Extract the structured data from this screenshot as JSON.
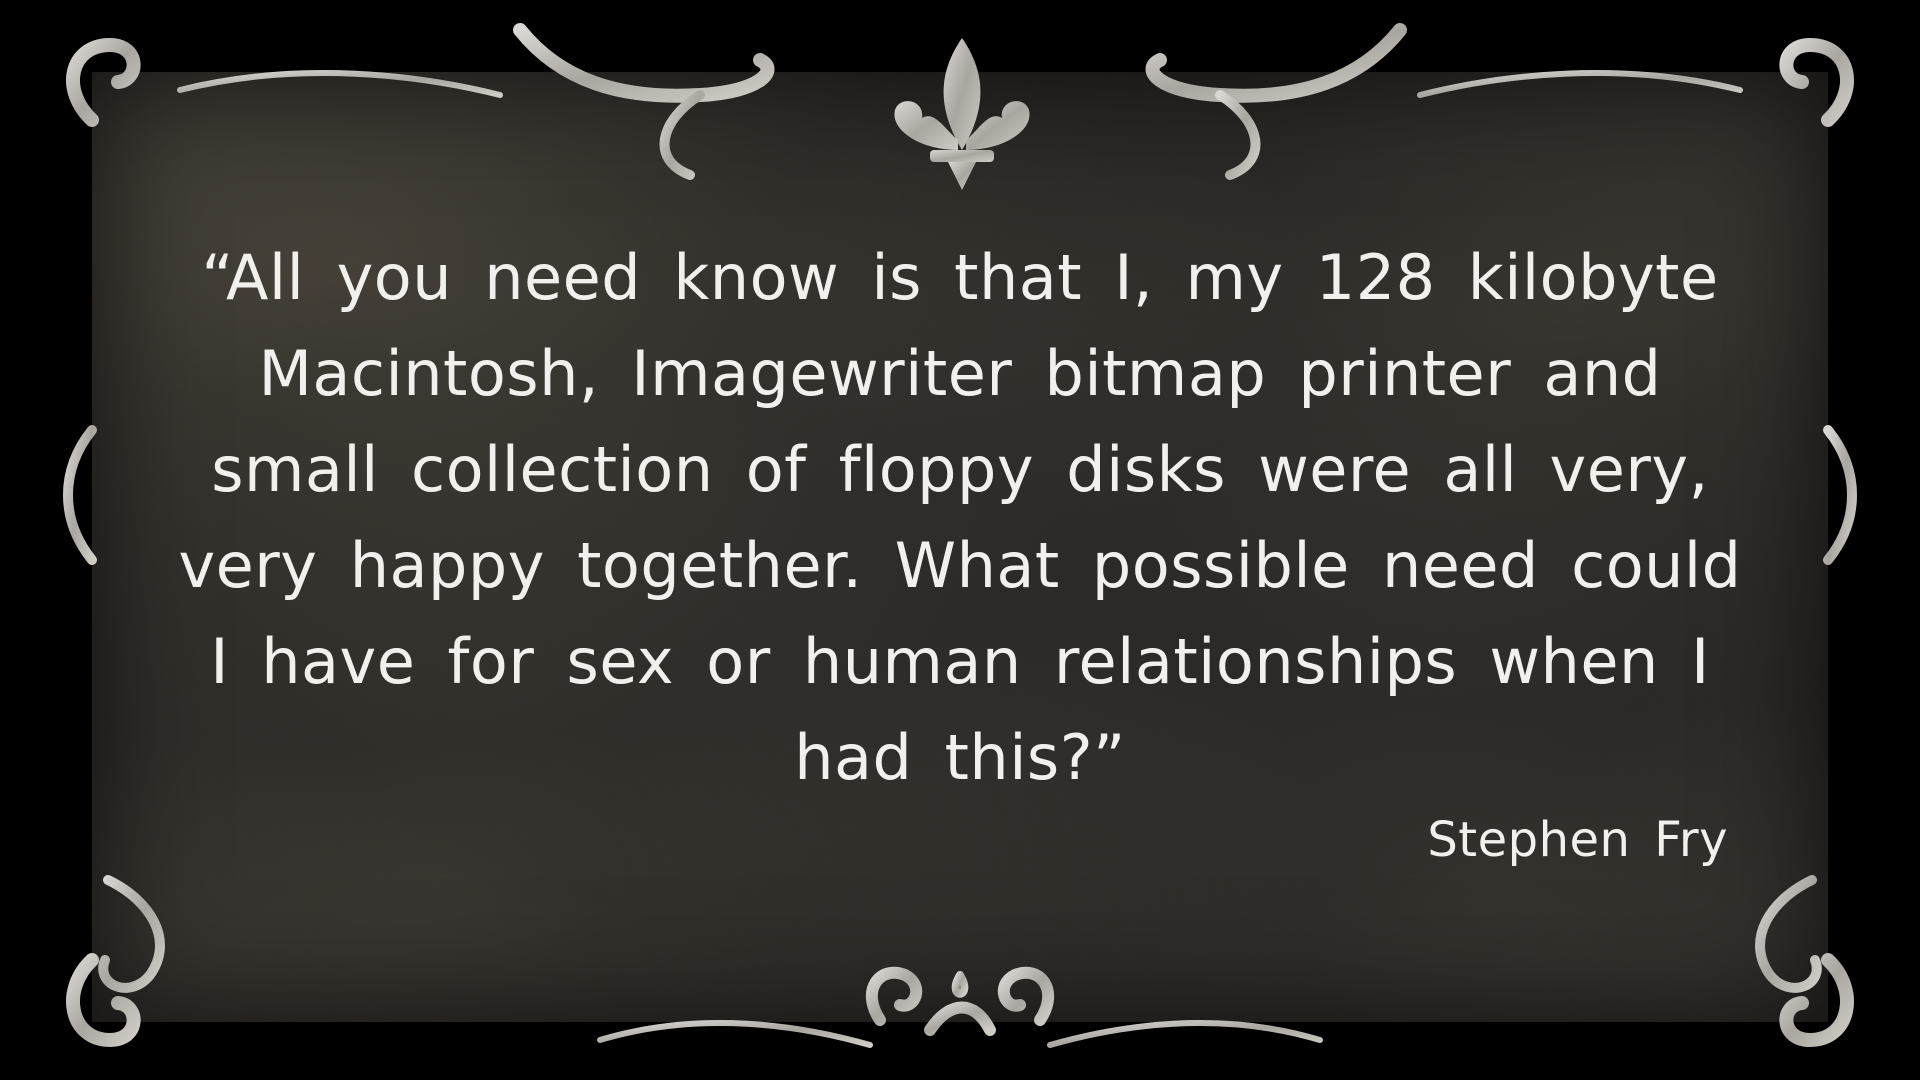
{
  "slide": {
    "quote": "“All you need know is that I, my 128 kilobyte Macintosh, Imagewriter bitmap printer and small collection of floppy disks were all very, very happy together. What possible need could I have for sex or human relationships when I had this?”",
    "author": "Stephen Fry"
  },
  "colors": {
    "background": "#000000",
    "panel": "#1f1e1d",
    "frame": "#bdbab4",
    "text": "#f2f0ec"
  },
  "icons": {
    "top_ornament": "fleur-de-lis-icon",
    "bottom_ornament": "scroll-flourish-icon"
  }
}
